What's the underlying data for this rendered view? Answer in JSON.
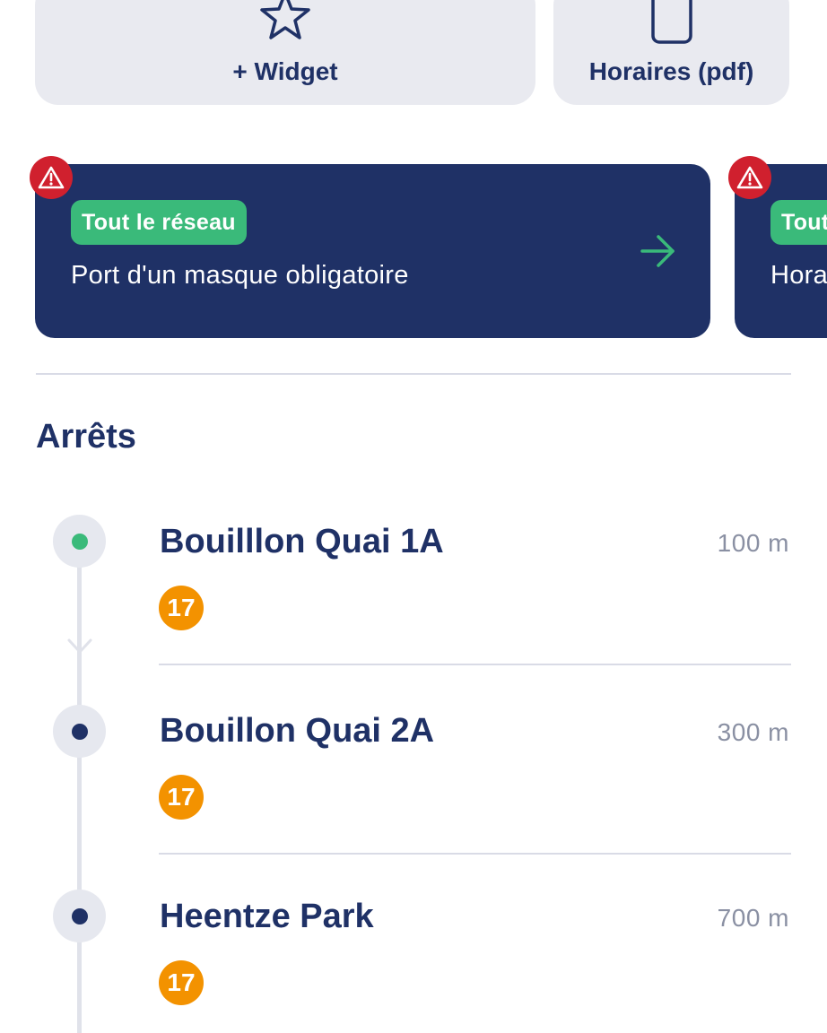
{
  "actions": {
    "widget": {
      "label": "+ Widget",
      "icon": "star-icon"
    },
    "timetable": {
      "label": "Horaires (pdf)",
      "icon": "document-icon"
    }
  },
  "alerts": [
    {
      "scope": "Tout le réseau",
      "message": "Port d'un masque obligatoire",
      "icon": "warning-icon",
      "arrow_icon": "arrow-right-icon"
    },
    {
      "scope": "Tout",
      "message": "Hora",
      "icon": "warning-icon"
    }
  ],
  "stops_section": {
    "title": "Arrêts",
    "stops": [
      {
        "name": "Bouilllon Quai 1A",
        "distance": "100 m",
        "lines": [
          "17"
        ],
        "current": true
      },
      {
        "name": "Bouillon Quai 2A",
        "distance": "300 m",
        "lines": [
          "17"
        ],
        "current": false
      },
      {
        "name": "Heentze Park",
        "distance": "700 m",
        "lines": [
          "17"
        ],
        "current": false
      }
    ]
  },
  "colors": {
    "navy": "#1f3166",
    "green": "#3aba7a",
    "alert_red": "#d0202e",
    "line_17": "#f39200",
    "card_grey": "#e9eaf0"
  }
}
